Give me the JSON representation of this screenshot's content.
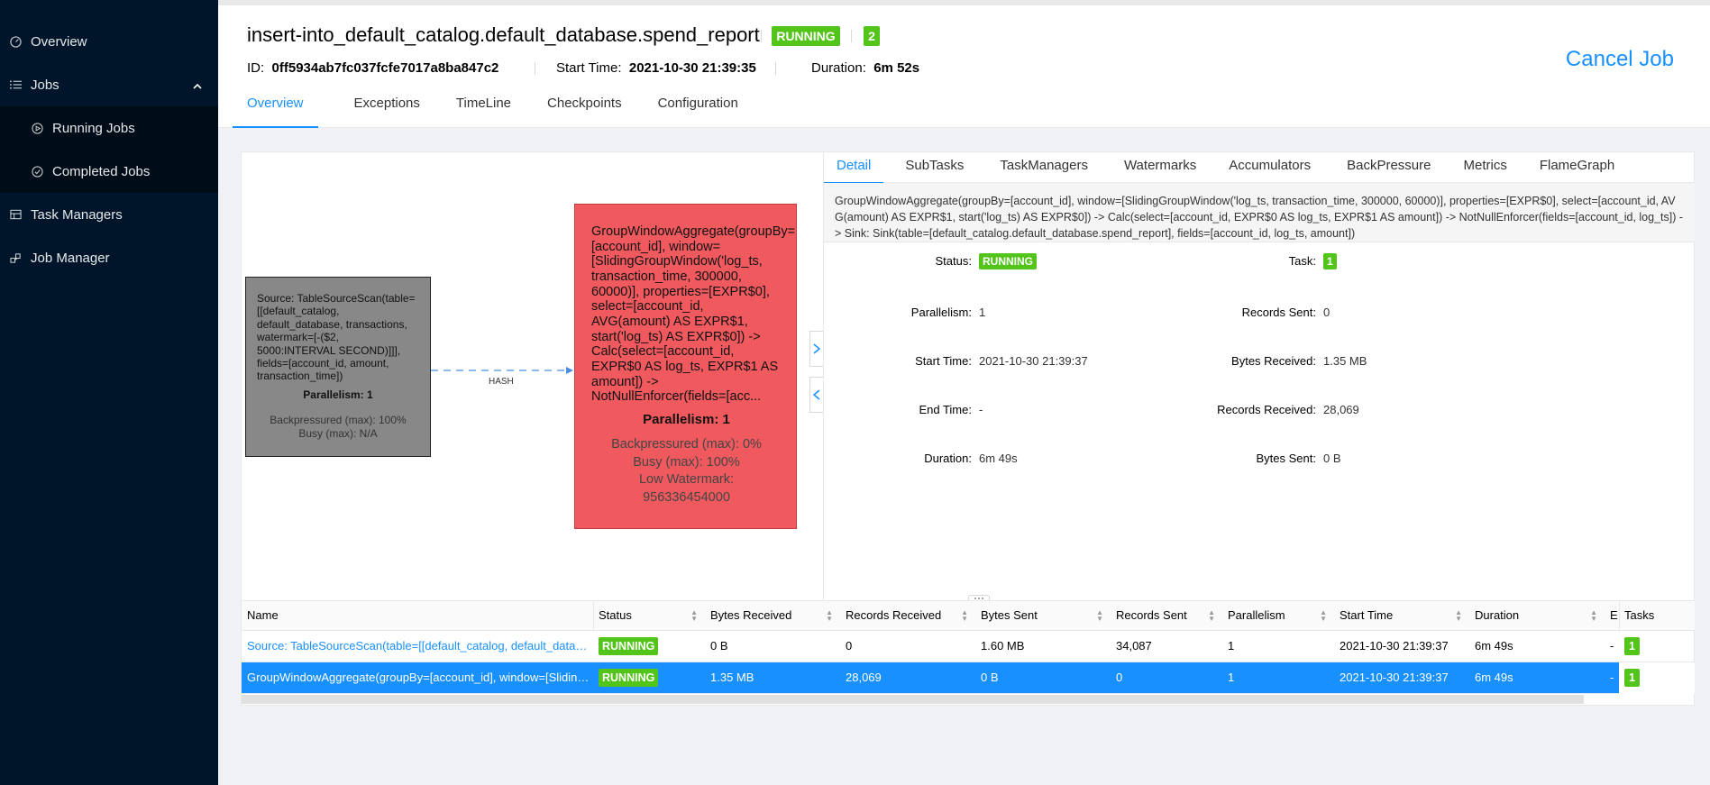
{
  "sidebar": {
    "items": [
      {
        "label": "Overview",
        "icon": "dashboard-icon"
      },
      {
        "label": "Jobs",
        "icon": "list-icon"
      },
      {
        "label": "Running Jobs",
        "icon": "play-circle-icon"
      },
      {
        "label": "Completed Jobs",
        "icon": "check-circle-icon"
      },
      {
        "label": "Task Managers",
        "icon": "task-manager-icon"
      },
      {
        "label": "Job Manager",
        "icon": "cluster-icon"
      }
    ]
  },
  "header": {
    "title": "insert-into_default_catalog.default_database.spend_report",
    "status": "RUNNING",
    "task_count": "2",
    "id_label": "ID:",
    "id_value": "0ff5934ab7fc037fcfe7017a8ba847c2",
    "start_label": "Start Time:",
    "start_value": "2021-10-30 21:39:35",
    "duration_label": "Duration:",
    "duration_value": "6m 52s",
    "cancel_label": "Cancel Job",
    "tabs": [
      "Overview",
      "Exceptions",
      "TimeLine",
      "Checkpoints",
      "Configuration"
    ]
  },
  "graph": {
    "node1": {
      "desc": "Source: TableSourceScan(table=[[default_catalog, default_database, transactions, watermark=[-($2, 5000:INTERVAL SECOND)]]], fields=[account_id, amount, transaction_time])",
      "parallelism": "Parallelism: 1",
      "backpressured": "Backpressured (max): 100%",
      "busy": "Busy (max): N/A"
    },
    "edge_label": "HASH",
    "node2": {
      "desc": "GroupWindowAggregate(groupBy=[account_id], window=[SlidingGroupWindow('log_ts, transaction_time, 300000, 60000)], properties=[EXPR$0], select=[account_id, AVG(amount) AS EXPR$1, start('log_ts) AS EXPR$0]) -> Calc(select=[account_id, EXPR$0 AS log_ts, EXPR$1 AS amount]) -> NotNullEnforcer(fields=[acc...",
      "parallelism": "Parallelism: 1",
      "backpressured": "Backpressured (max): 0%",
      "busy": "Busy (max): 100%",
      "watermark": "Low Watermark: 956336454000"
    }
  },
  "detail": {
    "tabs": [
      "Detail",
      "SubTasks",
      "TaskManagers",
      "Watermarks",
      "Accumulators",
      "BackPressure",
      "Metrics",
      "FlameGraph"
    ],
    "description": "GroupWindowAggregate(groupBy=[account_id], window=[SlidingGroupWindow('log_ts, transaction_time, 300000, 60000)], properties=[EXPR$0], select=[account_id, AVG(amount) AS EXPR$1, start('log_ts) AS EXPR$0]) -> Calc(select=[account_id, EXPR$0 AS log_ts, EXPR$1 AS amount]) -> NotNullEnforcer(fields=[account_id, log_ts]) -> Sink: Sink(table=[default_catalog.default_database.spend_report], fields=[account_id, log_ts, amount])",
    "status_label": "Status",
    "status_value": "RUNNING",
    "task_label": "Task",
    "task_value": "1",
    "parallelism_label": "Parallelism",
    "parallelism_value": "1",
    "records_sent_label": "Records Sent",
    "records_sent_value": "0",
    "start_time_label": "Start Time",
    "start_time_value": "2021-10-30 21:39:37",
    "bytes_received_label": "Bytes Received",
    "bytes_received_value": "1.35 MB",
    "end_time_label": "End Time",
    "end_time_value": "-",
    "records_received_label": "Records Received",
    "records_received_value": "28,069",
    "duration_label": "Duration",
    "duration_value": "6m 49s",
    "bytes_sent_label": "Bytes Sent",
    "bytes_sent_value": "0 B"
  },
  "table": {
    "headers": [
      "Name",
      "Status",
      "Bytes Received",
      "Records Received",
      "Bytes Sent",
      "Records Sent",
      "Parallelism",
      "Start Time",
      "Duration",
      "E",
      "Tasks"
    ],
    "rows": [
      {
        "name": "Source: TableSourceScan(table=[[default_catalog, default_database, transactions, watermark=[-($2, 5000:INTERVAL SECOND)]]], fields=[account_id, amount, transaction_time])",
        "status": "RUNNING",
        "bytes_received": "0 B",
        "records_received": "0",
        "bytes_sent": "1.60 MB",
        "records_sent": "34,087",
        "parallelism": "1",
        "start_time": "2021-10-30 21:39:37",
        "duration": "6m 49s",
        "end": "-",
        "tasks": "1"
      },
      {
        "name": "GroupWindowAggregate(groupBy=[account_id], window=[SlidingGroupWindow('log_ts, transaction_time, 300000, 60000)]",
        "status": "RUNNING",
        "bytes_received": "1.35 MB",
        "records_received": "28,069",
        "bytes_sent": "0 B",
        "records_sent": "0",
        "parallelism": "1",
        "start_time": "2021-10-30 21:39:37",
        "duration": "6m 49s",
        "end": "-",
        "tasks": "1"
      }
    ]
  },
  "colors": {
    "sidebar_bg": "#001529",
    "accent": "#1890ff",
    "running": "#52c41a",
    "node_backpressured": "#888888",
    "node_busy": "#f05a5f"
  }
}
